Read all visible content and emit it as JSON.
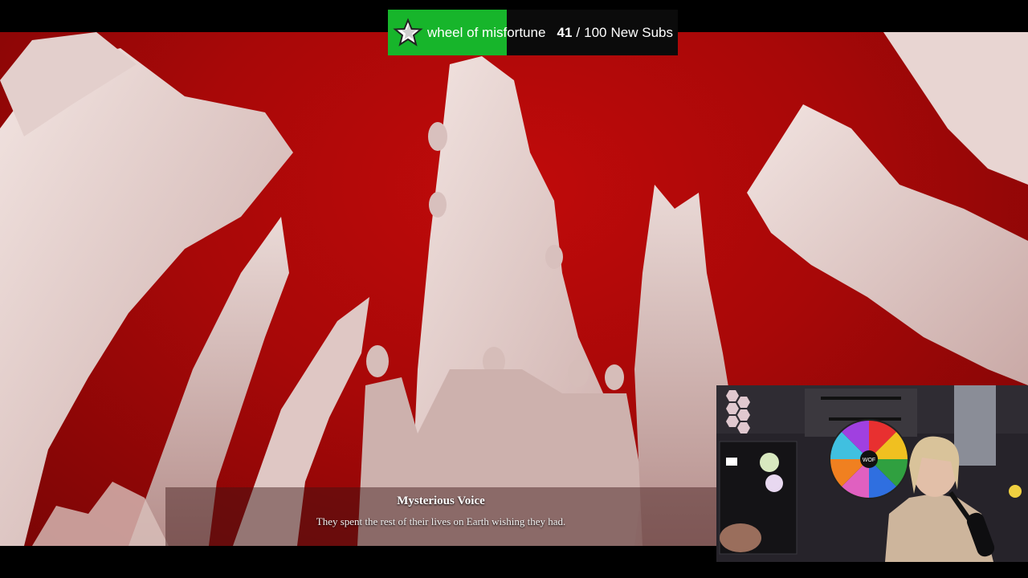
{
  "stream_goal": {
    "title": "wheel of misfortune",
    "current": "41",
    "separator": "/",
    "target": "100",
    "unit": "New Subs",
    "progress_fraction": 0.41,
    "fill_color": "#17b52b",
    "icon": "star-icon"
  },
  "dialogue": {
    "speaker": "Mysterious Voice",
    "line": "They spent the rest of their lives on Earth wishing they had."
  },
  "game_scene": {
    "palette": {
      "sky": "#b00808",
      "trees": "#e7d3d0"
    }
  },
  "webcam": {
    "wheel_center_label": "WOF"
  }
}
